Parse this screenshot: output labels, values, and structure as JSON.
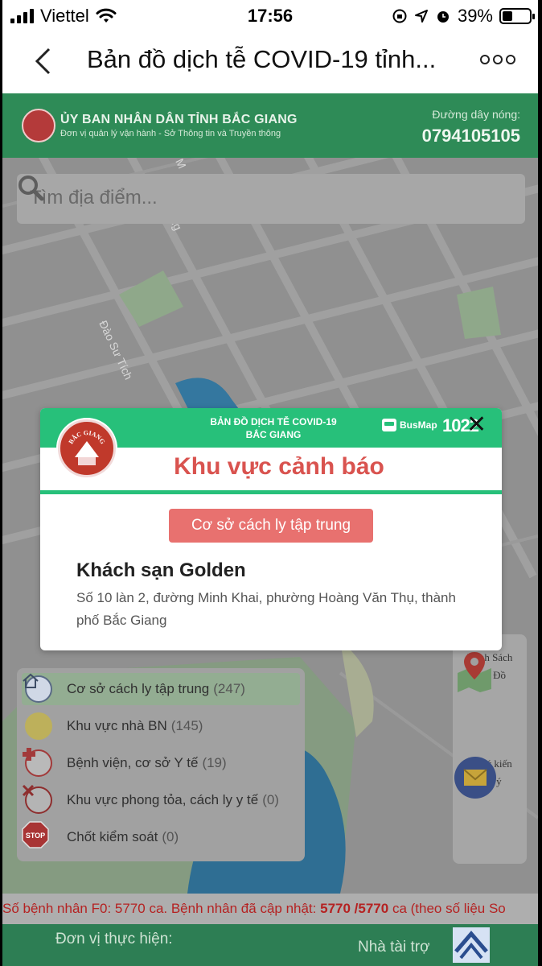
{
  "status_bar": {
    "carrier": "Viettel",
    "time": "17:56",
    "battery": "39%",
    "battery_level": 0.39
  },
  "nav": {
    "title": "Bản đồ dịch tễ COVID-19 tỉnh..."
  },
  "gov_header": {
    "name": "ỦY BAN NHÂN DÂN TỈNH BẮC GIANG",
    "subtitle": "Đơn vị quản lý vận hành - Sở Thông tin và Truyền thông",
    "hotline_label": "Đường dây nóng:",
    "hotline_number": "0794105105"
  },
  "search": {
    "placeholder": "Tìm địa điểm..."
  },
  "map_labels": {
    "street_dao_su_tich": "Đào Sư Tích",
    "street_frag_ong": "ong",
    "street_frag_m": "M"
  },
  "modal": {
    "top_title_line1": "BẢN ĐỒ DỊCH TỄ COVID-19",
    "top_title_line2": "BẮC GIANG",
    "busmap_label": "BusMap",
    "hotline_short": "1022",
    "logo_text": "BẮC GIANG",
    "heading": "Khu vực cảnh báo",
    "tag": "Cơ sở cách ly tập trung",
    "place_name": "Khách sạn Golden",
    "address": "Số 10 làn 2, đường Minh Khai, phường Hoàng Văn Thụ, thành phố Bắc Giang"
  },
  "legend": {
    "items": [
      {
        "label": "Cơ sở cách ly tập trung",
        "count": "(247)",
        "icon": "house-icon"
      },
      {
        "label": "Khu vực nhà BN",
        "count": "(145)",
        "icon": "yellow-dot-icon"
      },
      {
        "label": "Bệnh viện, cơ sở Y tế",
        "count": "(19)",
        "icon": "medical-cross-icon"
      },
      {
        "label": "Khu vực phong tỏa, cách ly y tế",
        "count": "(0)",
        "icon": "x-mark-icon"
      },
      {
        "label": "Chốt kiểm soát",
        "count": "(0)",
        "icon": "stop-sign-icon"
      }
    ],
    "stop_text": "STOP"
  },
  "side_panel": {
    "map_list_line1": "Danh Sách",
    "map_list_line2": "Bản Đồ",
    "feedback_line1": "Gửi ý kiến",
    "feedback_line2": "góp ý"
  },
  "ticker": {
    "prefix": "Số bệnh nhân F0: 5770",
    "mid": "ca. Bệnh nhân đã cập nhật:",
    "ratio": "5770 /5770",
    "suffix": "ca (theo số liệu So"
  },
  "footer": {
    "implementer_label": "Đơn vị thực hiện:",
    "sponsor_label": "Nhà tài trợ"
  },
  "colors": {
    "brand_green": "#2e8b57",
    "modal_green": "#27c07a",
    "warning_red": "#d9534f",
    "tag_red": "#e8716f"
  }
}
